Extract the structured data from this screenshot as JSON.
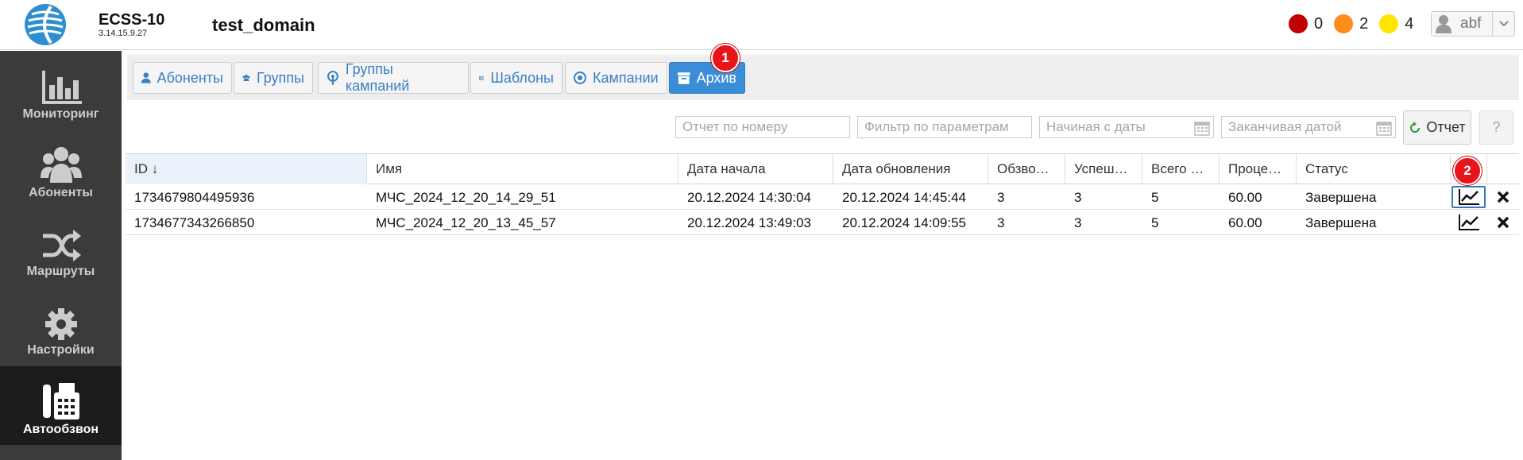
{
  "header": {
    "app_name": "ECSS-10",
    "version": "3.14.15.9.27",
    "domain": "test_domain",
    "alarms": [
      {
        "color": "#c00000",
        "count": "0"
      },
      {
        "color": "#ff8c1a",
        "count": "2"
      },
      {
        "color": "#ffe600",
        "count": "4"
      }
    ],
    "user": "abf"
  },
  "sidebar": {
    "items": [
      {
        "label": "Мониторинг",
        "icon": "bar-chart-icon"
      },
      {
        "label": "Абоненты",
        "icon": "users-icon"
      },
      {
        "label": "Маршруты",
        "icon": "shuffle-icon"
      },
      {
        "label": "Настройки",
        "icon": "gear-icon"
      },
      {
        "label": "Автообзвон",
        "icon": "fax-phone-icon",
        "active": true
      }
    ]
  },
  "tabs": [
    {
      "label": "Абоненты",
      "icon": "user-icon"
    },
    {
      "label": "Группы",
      "icon": "users-icon"
    },
    {
      "label": "Группы кампаний",
      "icon": "broadcast-icon"
    },
    {
      "label": "Шаблоны",
      "icon": "template-icon"
    },
    {
      "label": "Кампании",
      "icon": "target-icon"
    },
    {
      "label": "Архив",
      "icon": "archive-icon",
      "active": true
    }
  ],
  "badges": [
    "1",
    "2"
  ],
  "filters": {
    "number_placeholder": "Отчет по номеру",
    "params_placeholder": "Фильтр по параметрам",
    "from_placeholder": "Начиная с даты",
    "to_placeholder": "Заканчивая датой",
    "report_label": "Отчет",
    "help_label": "?"
  },
  "table": {
    "headers": [
      "ID ↓",
      "Имя",
      "Дата начала",
      "Дата обновления",
      "Обзво…",
      "Успеш…",
      "Всего …",
      "Проце…",
      "Статус"
    ],
    "rows": [
      [
        "1734679804495936",
        "МЧС_2024_12_20_14_29_51",
        "20.12.2024 14:30:04",
        "20.12.2024 14:45:44",
        "3",
        "3",
        "5",
        "60.00",
        "Завершена"
      ],
      [
        "1734677343266850",
        "МЧС_2024_12_20_13_45_57",
        "20.12.2024 13:49:03",
        "20.12.2024 14:09:55",
        "3",
        "3",
        "5",
        "60.00",
        "Завершена"
      ]
    ]
  }
}
